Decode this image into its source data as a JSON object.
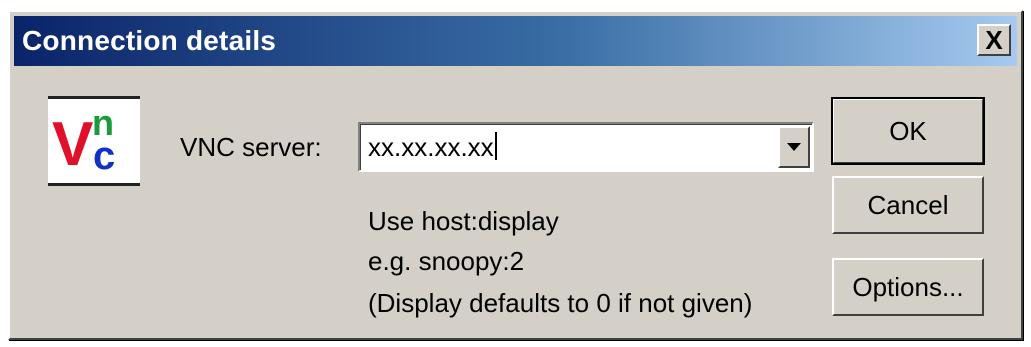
{
  "window": {
    "title": "Connection details",
    "close_symbol": "X"
  },
  "logo": {
    "name": "vnc-logo",
    "letters": [
      "V",
      "n",
      "c"
    ],
    "colors": {
      "v": "#e0102a",
      "n": "#1a9a3a",
      "c": "#1030c8"
    }
  },
  "form": {
    "server_label": "VNC server:",
    "server_value": "xx.xx.xx.xx",
    "hint_lines": [
      "Use host:display",
      "e.g. snoopy:2",
      "(Display defaults to 0 if not given)"
    ]
  },
  "buttons": {
    "ok": "OK",
    "cancel": "Cancel",
    "options": "Options..."
  },
  "colors": {
    "face": "#d4d0c8",
    "title_start": "#0a246a",
    "title_end": "#a6caf0"
  }
}
